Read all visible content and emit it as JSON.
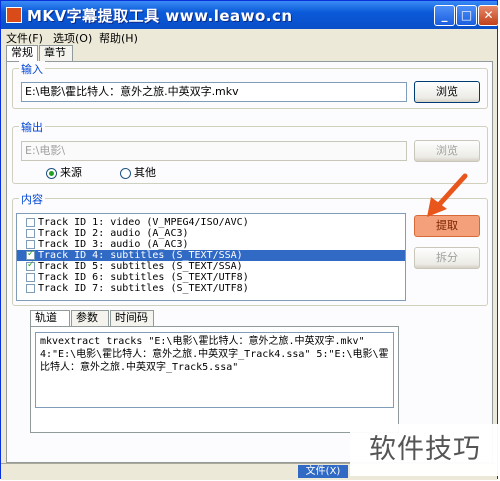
{
  "window": {
    "title": "MKV字幕提取工具 www.leawo.cn",
    "controls": {
      "minimize": "_",
      "maximize": "□",
      "close": "✕"
    }
  },
  "menu": [
    "文件(F)",
    "选项(O)",
    "帮助(H)"
  ],
  "main_tabs": [
    {
      "label": "常规",
      "active": true
    },
    {
      "label": "章节",
      "active": false
    }
  ],
  "input": {
    "group_title": "输入",
    "path": "E:\\电影\\霍比特人：意外之旅.中英双字.mkv",
    "browse_label": "浏览"
  },
  "output": {
    "group_title": "输出",
    "path": "E:\\电影\\",
    "browse_label": "浏览",
    "radio_source": "来源",
    "radio_other": "其他",
    "selected": "来源"
  },
  "content": {
    "group_title": "内容",
    "tracks": [
      {
        "label": "Track ID 1: video (V_MPEG4/ISO/AVC)",
        "checked": false,
        "selected": false
      },
      {
        "label": "Track ID 2: audio (A_AC3)",
        "checked": false,
        "selected": false
      },
      {
        "label": "Track ID 3: audio (A_AC3)",
        "checked": false,
        "selected": false
      },
      {
        "label": "Track ID 4: subtitles (S_TEXT/SSA)",
        "checked": true,
        "selected": true
      },
      {
        "label": "Track ID 5: subtitles (S_TEXT/SSA)",
        "checked": true,
        "selected": false
      },
      {
        "label": "Track ID 6: subtitles (S_TEXT/UTF8)",
        "checked": false,
        "selected": false
      },
      {
        "label": "Track ID 7: subtitles (S_TEXT/UTF8)",
        "checked": false,
        "selected": false
      }
    ],
    "extract_label": "提取",
    "split_label": "拆分",
    "sub_tabs": [
      {
        "label": "轨道",
        "active": true
      },
      {
        "label": "参数",
        "active": false
      },
      {
        "label": "时间码",
        "active": false
      }
    ],
    "command": "mkvextract tracks \"E:\\电影\\霍比特人：意外之旅.中英双字.mkv\" 4:\"E:\\电影\\霍比特人：意外之旅.中英双字_Track4.ssa\" 5:\"E:\\电影\\霍比特人：意外之旅.中英双字_Track5.ssa\""
  },
  "status": {
    "pane": "文件(X)"
  },
  "watermark": "软件技巧",
  "colors": {
    "title_bar": "#0a4fc8",
    "group_title": "#0046d5",
    "selection": "#316ac5",
    "extract_button": "#f4a07a",
    "arrow": "#e8561c"
  }
}
